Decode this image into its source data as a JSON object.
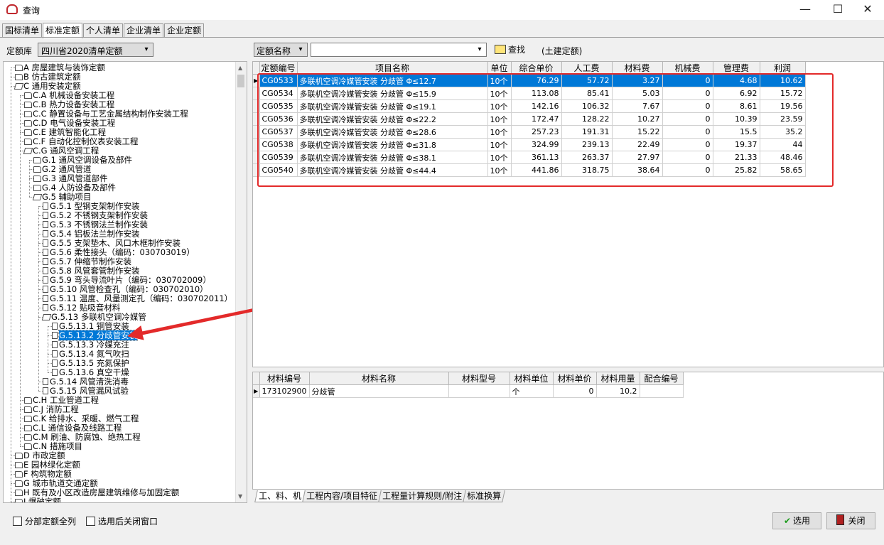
{
  "window": {
    "title": "查询",
    "minimize": "—",
    "maximize": "☐",
    "close": "✕"
  },
  "tabs": [
    "国标清单",
    "标准定额",
    "个人清单",
    "企业清单",
    "企业定额"
  ],
  "active_tab": 1,
  "library": {
    "label": "定额库",
    "value": "四川省2020清单定额"
  },
  "search": {
    "field": "定额名称",
    "value": "",
    "button": "查找",
    "scope": "(土建定额)"
  },
  "tree": [
    {
      "t": "A 房屋建筑与装饰定额",
      "d": 0,
      "i": "folder"
    },
    {
      "t": "B 仿古建筑定额",
      "d": 0,
      "i": "folder"
    },
    {
      "t": "C 通用安装定额",
      "d": 0,
      "i": "open"
    },
    {
      "t": "C.A 机械设备安装工程",
      "d": 1,
      "i": "folder"
    },
    {
      "t": "C.B 热力设备安装工程",
      "d": 1,
      "i": "folder"
    },
    {
      "t": "C.C 静置设备与工艺金属结构制作安装工程",
      "d": 1,
      "i": "folder"
    },
    {
      "t": "C.D 电气设备安装工程",
      "d": 1,
      "i": "folder"
    },
    {
      "t": "C.E 建筑智能化工程",
      "d": 1,
      "i": "folder"
    },
    {
      "t": "C.F 自动化控制仪表安装工程",
      "d": 1,
      "i": "folder"
    },
    {
      "t": "C.G 通风空调工程",
      "d": 1,
      "i": "open"
    },
    {
      "t": "G.1 通风空调设备及部件",
      "d": 2,
      "i": "folder"
    },
    {
      "t": "G.2 通风管道",
      "d": 2,
      "i": "folder"
    },
    {
      "t": "G.3 通风管道部件",
      "d": 2,
      "i": "folder"
    },
    {
      "t": "G.4 人防设备及部件",
      "d": 2,
      "i": "folder"
    },
    {
      "t": "G.5 辅助项目",
      "d": 2,
      "i": "open"
    },
    {
      "t": "G.5.1 型钢支架制作安装",
      "d": 3,
      "i": "doc"
    },
    {
      "t": "G.5.2 不锈钢支架制作安装",
      "d": 3,
      "i": "doc"
    },
    {
      "t": "G.5.3 不锈钢法兰制作安装",
      "d": 3,
      "i": "doc"
    },
    {
      "t": "G.5.4 铝板法兰制作安装",
      "d": 3,
      "i": "doc"
    },
    {
      "t": "G.5.5 支架垫木、风口木框制作安装",
      "d": 3,
      "i": "doc"
    },
    {
      "t": "G.5.6 柔性接头（编码：030703019）",
      "d": 3,
      "i": "doc"
    },
    {
      "t": "G.5.7 伸缩节制作安装",
      "d": 3,
      "i": "doc"
    },
    {
      "t": "G.5.8 风管套管制作安装",
      "d": 3,
      "i": "doc"
    },
    {
      "t": "G.5.9 弯头导流叶片（编码：030702009）",
      "d": 3,
      "i": "doc"
    },
    {
      "t": "G.5.10 风管检查孔（编码：030702010）",
      "d": 3,
      "i": "doc"
    },
    {
      "t": "G.5.11 温度、风量测定孔（编码：030702011）",
      "d": 3,
      "i": "doc"
    },
    {
      "t": "G.5.12 贴吸音材料",
      "d": 3,
      "i": "doc"
    },
    {
      "t": "G.5.13 多联机空调冷媒管",
      "d": 3,
      "i": "open"
    },
    {
      "t": "G.5.13.1 铜管安装",
      "d": 4,
      "i": "doc"
    },
    {
      "t": "G.5.13.2 分歧管安装",
      "d": 4,
      "i": "doc",
      "sel": true
    },
    {
      "t": "G.5.13.3 冷媒充注",
      "d": 4,
      "i": "doc"
    },
    {
      "t": "G.5.13.4 氮气吹扫",
      "d": 4,
      "i": "doc"
    },
    {
      "t": "G.5.13.5 充氮保护",
      "d": 4,
      "i": "doc"
    },
    {
      "t": "G.5.13.6 真空干燥",
      "d": 4,
      "i": "doc"
    },
    {
      "t": "G.5.14 风管清洗消毒",
      "d": 3,
      "i": "doc"
    },
    {
      "t": "G.5.15 风管漏风试验",
      "d": 3,
      "i": "doc"
    },
    {
      "t": "C.H 工业管道工程",
      "d": 1,
      "i": "folder"
    },
    {
      "t": "C.J 消防工程",
      "d": 1,
      "i": "folder"
    },
    {
      "t": "C.K 给排水、采暖、燃气工程",
      "d": 1,
      "i": "folder"
    },
    {
      "t": "C.L 通信设备及线路工程",
      "d": 1,
      "i": "folder"
    },
    {
      "t": "C.M 刷油、防腐蚀、绝热工程",
      "d": 1,
      "i": "folder"
    },
    {
      "t": "C.N 措施项目",
      "d": 1,
      "i": "folder"
    },
    {
      "t": "D 市政定额",
      "d": 0,
      "i": "folder"
    },
    {
      "t": "E 园林绿化定额",
      "d": 0,
      "i": "folder"
    },
    {
      "t": "F 构筑物定额",
      "d": 0,
      "i": "folder"
    },
    {
      "t": "G 城市轨道交通定额",
      "d": 0,
      "i": "folder"
    },
    {
      "t": "H 既有及小区改造房屋建筑维修与加固定额",
      "d": 0,
      "i": "folder"
    },
    {
      "t": "J 爆破定额",
      "d": 0,
      "i": "folder"
    }
  ],
  "grid": {
    "headers": [
      "定额编号",
      "项目名称",
      "单位",
      "综合单价",
      "人工费",
      "材料费",
      "机械费",
      "管理费",
      "利润"
    ],
    "rows": [
      [
        "CG0533",
        "多联机空调冷媒管安装 分歧管 Φ≤12.7",
        "10个",
        "76.29",
        "57.72",
        "3.27",
        "0",
        "4.68",
        "10.62"
      ],
      [
        "CG0534",
        "多联机空调冷媒管安装 分歧管 Φ≤15.9",
        "10个",
        "113.08",
        "85.41",
        "5.03",
        "0",
        "6.92",
        "15.72"
      ],
      [
        "CG0535",
        "多联机空调冷媒管安装 分歧管 Φ≤19.1",
        "10个",
        "142.16",
        "106.32",
        "7.67",
        "0",
        "8.61",
        "19.56"
      ],
      [
        "CG0536",
        "多联机空调冷媒管安装 分歧管 Φ≤22.2",
        "10个",
        "172.47",
        "128.22",
        "10.27",
        "0",
        "10.39",
        "23.59"
      ],
      [
        "CG0537",
        "多联机空调冷媒管安装 分歧管 Φ≤28.6",
        "10个",
        "257.23",
        "191.31",
        "15.22",
        "0",
        "15.5",
        "35.2"
      ],
      [
        "CG0538",
        "多联机空调冷媒管安装 分歧管 Φ≤31.8",
        "10个",
        "324.99",
        "239.13",
        "22.49",
        "0",
        "19.37",
        "44"
      ],
      [
        "CG0539",
        "多联机空调冷媒管安装 分歧管 Φ≤38.1",
        "10个",
        "361.13",
        "263.37",
        "27.97",
        "0",
        "21.33",
        "48.46"
      ],
      [
        "CG0540",
        "多联机空调冷媒管安装 分歧管 Φ≤44.4",
        "10个",
        "441.86",
        "318.75",
        "38.64",
        "0",
        "25.82",
        "58.65"
      ]
    ],
    "selected": 0
  },
  "materials": {
    "headers": [
      "材料编号",
      "材料名称",
      "材料型号",
      "材料单位",
      "材料单价",
      "材料用量",
      "配合编号"
    ],
    "rows": [
      [
        "173102900",
        "分歧管",
        "",
        "个",
        "0",
        "10.2",
        ""
      ]
    ]
  },
  "bottom_tabs": [
    "工、料、机",
    "工程内容/项目特征",
    "工程量计算规则/附注",
    "标准换算"
  ],
  "footer": {
    "check_all": "分部定额全列",
    "check_close": "选用后关闭窗口",
    "select": "选用",
    "close": "关闭"
  },
  "colors": {
    "highlight": "#0078d7",
    "annotation": "#e32a2a"
  }
}
